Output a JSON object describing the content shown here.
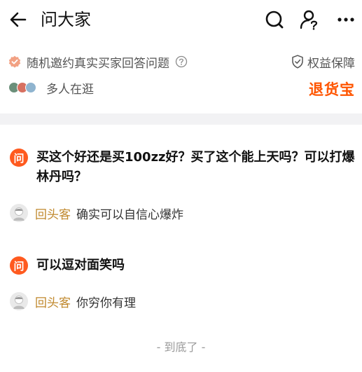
{
  "header": {
    "title": "问大家",
    "icons": [
      "back-arrow-icon",
      "search-icon",
      "profile-question-icon",
      "more-icon"
    ]
  },
  "info": {
    "invite_text": "随机邀约真实买家回答问题",
    "guarantee_text": "权益保障",
    "browsing_text": "多人在逛",
    "return_label": "退货宝"
  },
  "questions": [
    {
      "badge": "问",
      "text": "买这个好还是买100zz好？买了这个能上天吗？可以打爆林丹吗？",
      "answer_author": "回头客",
      "answer_text": "确实可以自信心爆炸"
    },
    {
      "badge": "问",
      "text": "可以逗对面笑吗",
      "answer_author": "回头客",
      "answer_text": "你穷你有理"
    }
  ],
  "footer": {
    "text": "- 到底了 -"
  },
  "colors": {
    "accent": "#ff5a1f",
    "return_label": "#ff5500",
    "author": "#c0882c",
    "divider": "#f2f2f4"
  }
}
